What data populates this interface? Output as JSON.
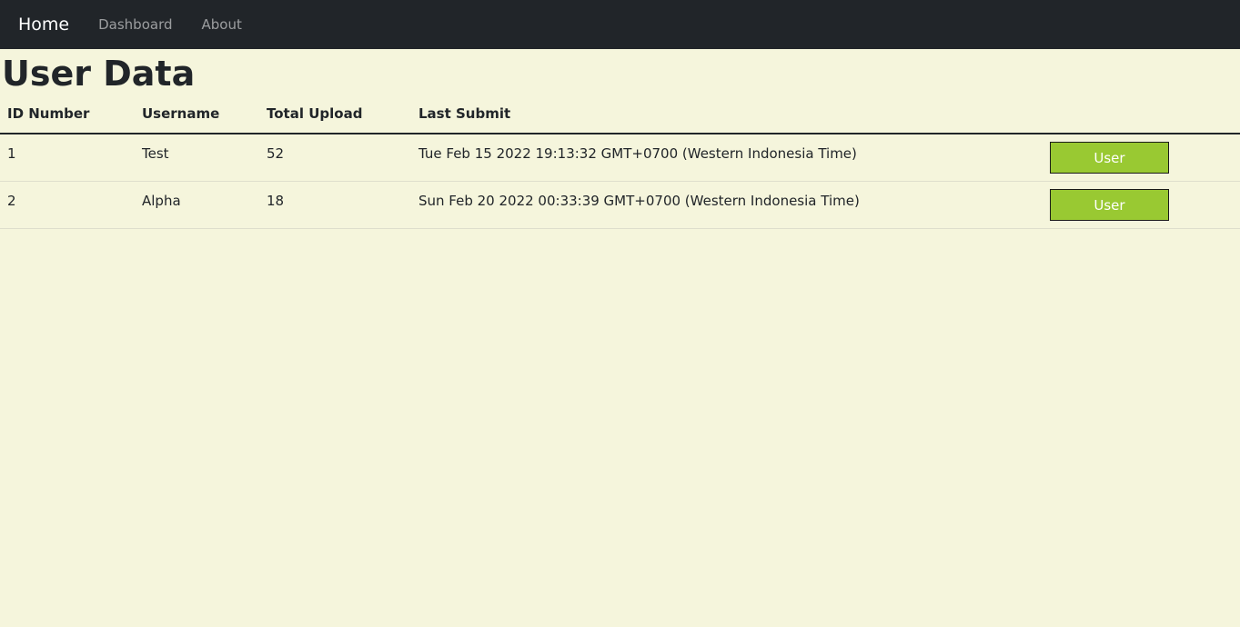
{
  "navbar": {
    "brand": "Home",
    "links": [
      "Dashboard",
      "About"
    ]
  },
  "page": {
    "title": "User Data"
  },
  "table": {
    "headers": [
      "ID Number",
      "Username",
      "Total Upload",
      "Last Submit",
      ""
    ],
    "rows": [
      {
        "id": "1",
        "username": "Test",
        "total_upload": "52",
        "last_submit": "Tue Feb 15 2022 19:13:32 GMT+0700 (Western Indonesia Time)",
        "action_label": "User"
      },
      {
        "id": "2",
        "username": "Alpha",
        "total_upload": "18",
        "last_submit": "Sun Feb 20 2022 00:33:39 GMT+0700 (Western Indonesia Time)",
        "action_label": "User"
      }
    ]
  },
  "colors": {
    "navbar_bg": "#212529",
    "page_bg": "#f5f5dc",
    "button_bg": "#99c932"
  }
}
